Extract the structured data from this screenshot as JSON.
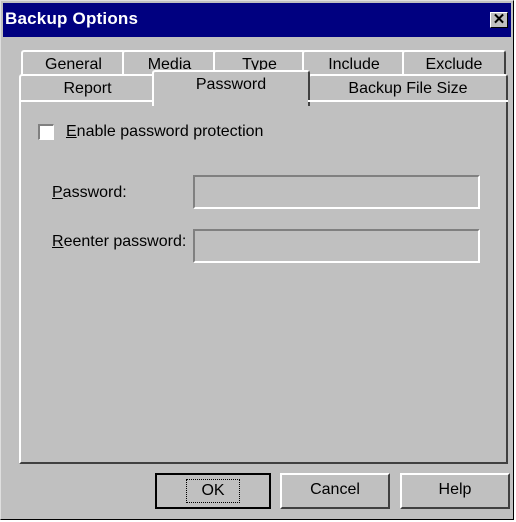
{
  "window": {
    "title": "Backup Options",
    "close_glyph": "✕"
  },
  "tabs_row1": [
    "General",
    "Media",
    "Type",
    "Include",
    "Exclude"
  ],
  "tabs_row2": [
    "Report",
    "Password",
    "Backup File Size"
  ],
  "active_tab": "Password",
  "password_panel": {
    "enable_checkbox": {
      "label_first": "E",
      "label_rest": "nable password protection",
      "checked": false
    },
    "password_label_first": "P",
    "password_label_rest": "assword:",
    "password_value": "",
    "reenter_label_first": "R",
    "reenter_label_rest": "eenter password:",
    "reenter_value": ""
  },
  "buttons": {
    "ok": "OK",
    "cancel": "Cancel",
    "help": "Help"
  }
}
